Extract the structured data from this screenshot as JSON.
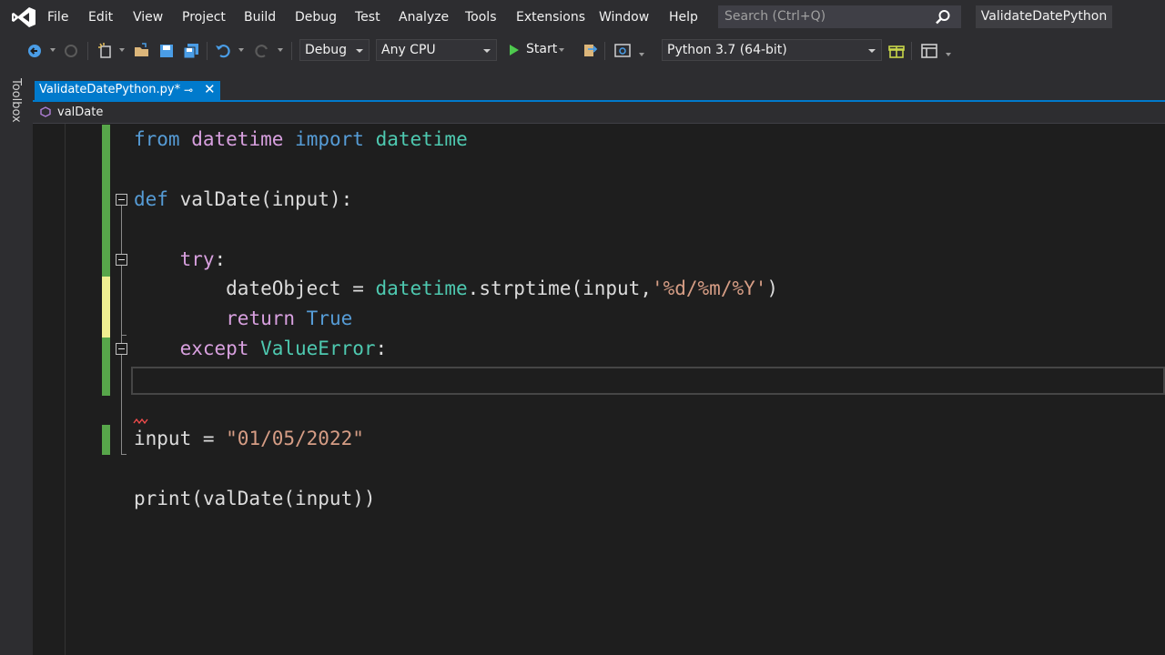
{
  "menu": {
    "items": [
      "File",
      "Edit",
      "View",
      "Project",
      "Build",
      "Debug",
      "Test",
      "Analyze",
      "Tools",
      "Extensions",
      "Window",
      "Help"
    ],
    "search_placeholder": "Search (Ctrl+Q)",
    "solution_name": "ValidateDatePython"
  },
  "toolbar": {
    "configuration": "Debug",
    "platform": "Any CPU",
    "start_label": "Start",
    "environment": "Python 3.7 (64-bit)"
  },
  "toolbox": {
    "label": "Toolbox"
  },
  "tabs": [
    {
      "title": "ValidateDatePython.py*",
      "pin": "⊸",
      "close": "✕"
    }
  ],
  "navbar": {
    "member": "valDate"
  },
  "code": {
    "l1": {
      "t1": "from",
      "t2": " ",
      "t3": "datetime",
      "t4": " ",
      "t5": "import",
      "t6": " ",
      "t7": "datetime"
    },
    "l2": {
      "t1": "def",
      "t2": " valDate(input):"
    },
    "l3": {
      "t1": "    ",
      "t2": "try",
      "t3": ":"
    },
    "l4": {
      "t1": "        dateObject = ",
      "t2": "datetime",
      "t3": ".strptime(input,",
      "t4": "'%d/%m/%Y'",
      "t5": ")"
    },
    "l5": {
      "t1": "        ",
      "t2": "return",
      "t3": " ",
      "t4": "True"
    },
    "l6": {
      "t1": "    ",
      "t2": "except",
      "t3": " ",
      "t4": "ValueError",
      "t5": ":"
    },
    "l7": {
      "t1": "input = ",
      "t2": "\"01/05/2022\""
    },
    "l8": {
      "t1": "print(valDate(input))"
    }
  },
  "colors": {
    "accent": "#007acc",
    "chrome": "#2d2d30",
    "editor_bg": "#1e1e1e",
    "keyword": "#569cd6",
    "control_keyword": "#d8a0df",
    "class_name": "#4ec9b0",
    "string": "#d69d85",
    "saved_change": "#57a64a",
    "unsaved_change": "#efef91"
  },
  "icons": [
    "vs-logo-icon",
    "search-icon",
    "back-icon",
    "forward-icon",
    "new-project-icon",
    "open-icon",
    "save-icon",
    "save-all-icon",
    "undo-icon",
    "redo-icon",
    "play-icon",
    "gift-icon",
    "layout-icon"
  ]
}
